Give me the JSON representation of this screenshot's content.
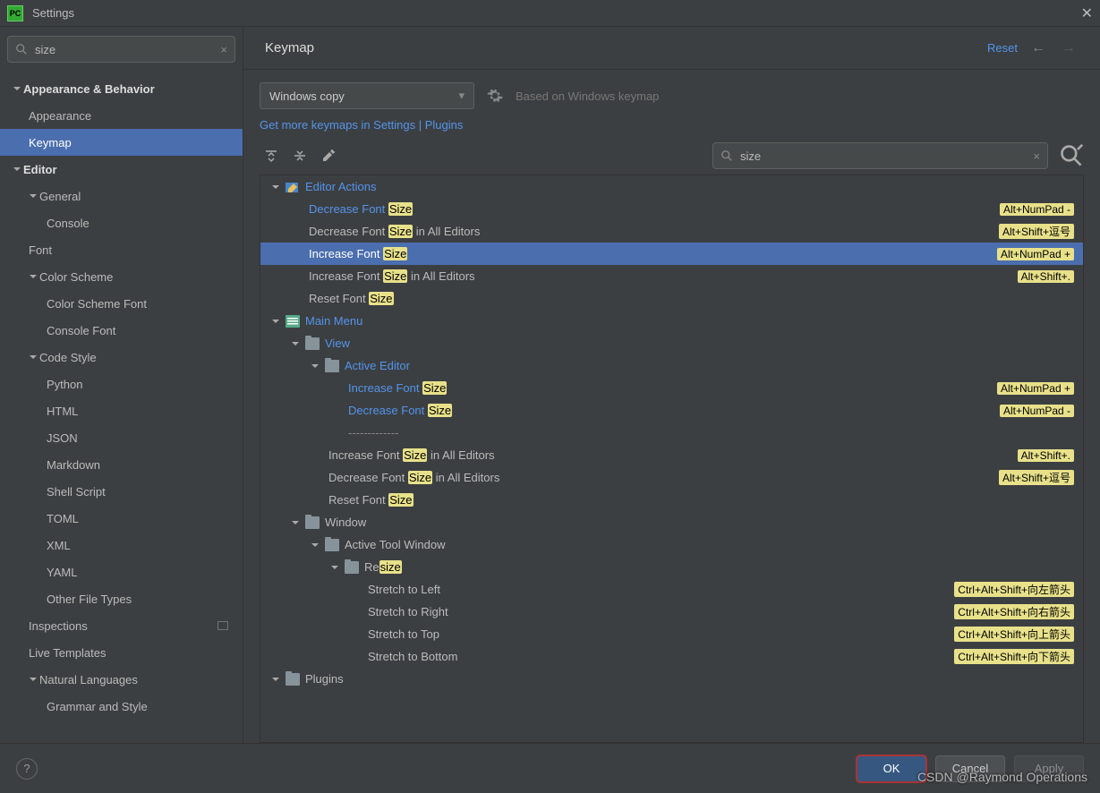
{
  "titlebar": {
    "title": "Settings"
  },
  "sidebar_search": {
    "value": "size"
  },
  "sidebar": {
    "items": [
      {
        "label": "Appearance & Behavior",
        "lvl": 0,
        "arrow": "down"
      },
      {
        "label": "Appearance",
        "lvl": 1
      },
      {
        "label": "Keymap",
        "lvl": 1,
        "selected": true
      },
      {
        "label": "Editor",
        "lvl": 0,
        "arrow": "down"
      },
      {
        "label": "General",
        "lvl": 1,
        "arrow": "down",
        "has_arrow": true
      },
      {
        "label": "Console",
        "lvl": 2
      },
      {
        "label": "Font",
        "lvl": 1
      },
      {
        "label": "Color Scheme",
        "lvl": 1,
        "arrow": "down",
        "has_arrow": true
      },
      {
        "label": "Color Scheme Font",
        "lvl": 2
      },
      {
        "label": "Console Font",
        "lvl": 2
      },
      {
        "label": "Code Style",
        "lvl": 1,
        "arrow": "down",
        "has_arrow": true
      },
      {
        "label": "Python",
        "lvl": 2
      },
      {
        "label": "HTML",
        "lvl": 2
      },
      {
        "label": "JSON",
        "lvl": 2
      },
      {
        "label": "Markdown",
        "lvl": 2
      },
      {
        "label": "Shell Script",
        "lvl": 2
      },
      {
        "label": "TOML",
        "lvl": 2
      },
      {
        "label": "XML",
        "lvl": 2
      },
      {
        "label": "YAML",
        "lvl": 2
      },
      {
        "label": "Other File Types",
        "lvl": 2
      },
      {
        "label": "Inspections",
        "lvl": 1,
        "sep": true
      },
      {
        "label": "Live Templates",
        "lvl": 1
      },
      {
        "label": "Natural Languages",
        "lvl": 1,
        "arrow": "down",
        "has_arrow": true
      },
      {
        "label": "Grammar and Style",
        "lvl": 2
      }
    ]
  },
  "main": {
    "title": "Keymap",
    "reset": "Reset",
    "scheme": "Windows copy",
    "basedon": "Based on Windows keymap",
    "morelink": "Get more keymaps in Settings | Plugins",
    "search": "size"
  },
  "keymap_tree": [
    {
      "pad": 10,
      "arrow": "down",
      "link": true,
      "icon": "edit",
      "parts": [
        [
          "Editor Actions",
          false
        ]
      ]
    },
    {
      "pad": 54,
      "link": true,
      "parts": [
        [
          "Decrease Font ",
          false
        ],
        [
          "Size",
          true
        ]
      ],
      "sc": "Alt+NumPad -"
    },
    {
      "pad": 54,
      "parts": [
        [
          "Decrease Font ",
          false
        ],
        [
          "Size",
          true
        ],
        [
          " in All Editors",
          false
        ]
      ],
      "sc": "Alt+Shift+逗号"
    },
    {
      "pad": 54,
      "link": true,
      "selected": true,
      "parts": [
        [
          "Increase Font ",
          false
        ],
        [
          "Size",
          true
        ]
      ],
      "sc": "Alt+NumPad +"
    },
    {
      "pad": 54,
      "parts": [
        [
          "Increase Font ",
          false
        ],
        [
          "Size",
          true
        ],
        [
          " in All Editors",
          false
        ]
      ],
      "sc": "Alt+Shift+."
    },
    {
      "pad": 54,
      "parts": [
        [
          "Reset Font ",
          false
        ],
        [
          "Size",
          true
        ]
      ]
    },
    {
      "pad": 10,
      "arrow": "down",
      "link": true,
      "icon": "menu",
      "parts": [
        [
          "Main Menu",
          false
        ]
      ]
    },
    {
      "pad": 32,
      "arrow": "down",
      "link": true,
      "icon": "folder",
      "parts": [
        [
          "View",
          false
        ]
      ]
    },
    {
      "pad": 54,
      "arrow": "down",
      "link": true,
      "icon": "folder",
      "parts": [
        [
          "Active Editor",
          false
        ]
      ]
    },
    {
      "pad": 98,
      "link": true,
      "parts": [
        [
          "Increase Font ",
          false
        ],
        [
          "Size",
          true
        ]
      ],
      "sc": "Alt+NumPad +"
    },
    {
      "pad": 98,
      "link": true,
      "parts": [
        [
          "Decrease Font ",
          false
        ],
        [
          "Size",
          true
        ]
      ],
      "sc": "Alt+NumPad -"
    },
    {
      "pad": 98,
      "sep": true,
      "parts": [
        [
          "-------------",
          false
        ]
      ]
    },
    {
      "pad": 76,
      "parts": [
        [
          "Increase Font ",
          false
        ],
        [
          "Size",
          true
        ],
        [
          " in All Editors",
          false
        ]
      ],
      "sc": "Alt+Shift+."
    },
    {
      "pad": 76,
      "parts": [
        [
          "Decrease Font ",
          false
        ],
        [
          "Size",
          true
        ],
        [
          " in All Editors",
          false
        ]
      ],
      "sc": "Alt+Shift+逗号"
    },
    {
      "pad": 76,
      "parts": [
        [
          "Reset Font ",
          false
        ],
        [
          "Size",
          true
        ]
      ]
    },
    {
      "pad": 32,
      "arrow": "down",
      "icon": "folder",
      "parts": [
        [
          "Window",
          false
        ]
      ]
    },
    {
      "pad": 54,
      "arrow": "down",
      "icon": "folder",
      "parts": [
        [
          "Active Tool Window",
          false
        ]
      ]
    },
    {
      "pad": 76,
      "arrow": "down",
      "icon": "folder",
      "parts": [
        [
          "Re",
          false
        ],
        [
          "size",
          true
        ]
      ]
    },
    {
      "pad": 120,
      "parts": [
        [
          "Stretch to Left",
          false
        ]
      ],
      "sc": "Ctrl+Alt+Shift+向左箭头"
    },
    {
      "pad": 120,
      "parts": [
        [
          "Stretch to Right",
          false
        ]
      ],
      "sc": "Ctrl+Alt+Shift+向右箭头"
    },
    {
      "pad": 120,
      "parts": [
        [
          "Stretch to Top",
          false
        ]
      ],
      "sc": "Ctrl+Alt+Shift+向上箭头"
    },
    {
      "pad": 120,
      "parts": [
        [
          "Stretch to Bottom",
          false
        ]
      ],
      "sc": "Ctrl+Alt+Shift+向下箭头"
    },
    {
      "pad": 10,
      "arrow": "down",
      "icon": "folder",
      "parts": [
        [
          "Plugins",
          false
        ]
      ]
    }
  ],
  "footer": {
    "ok": "OK",
    "cancel": "Cancel",
    "apply": "Apply"
  },
  "watermark": "CSDN @Raymond Operations"
}
